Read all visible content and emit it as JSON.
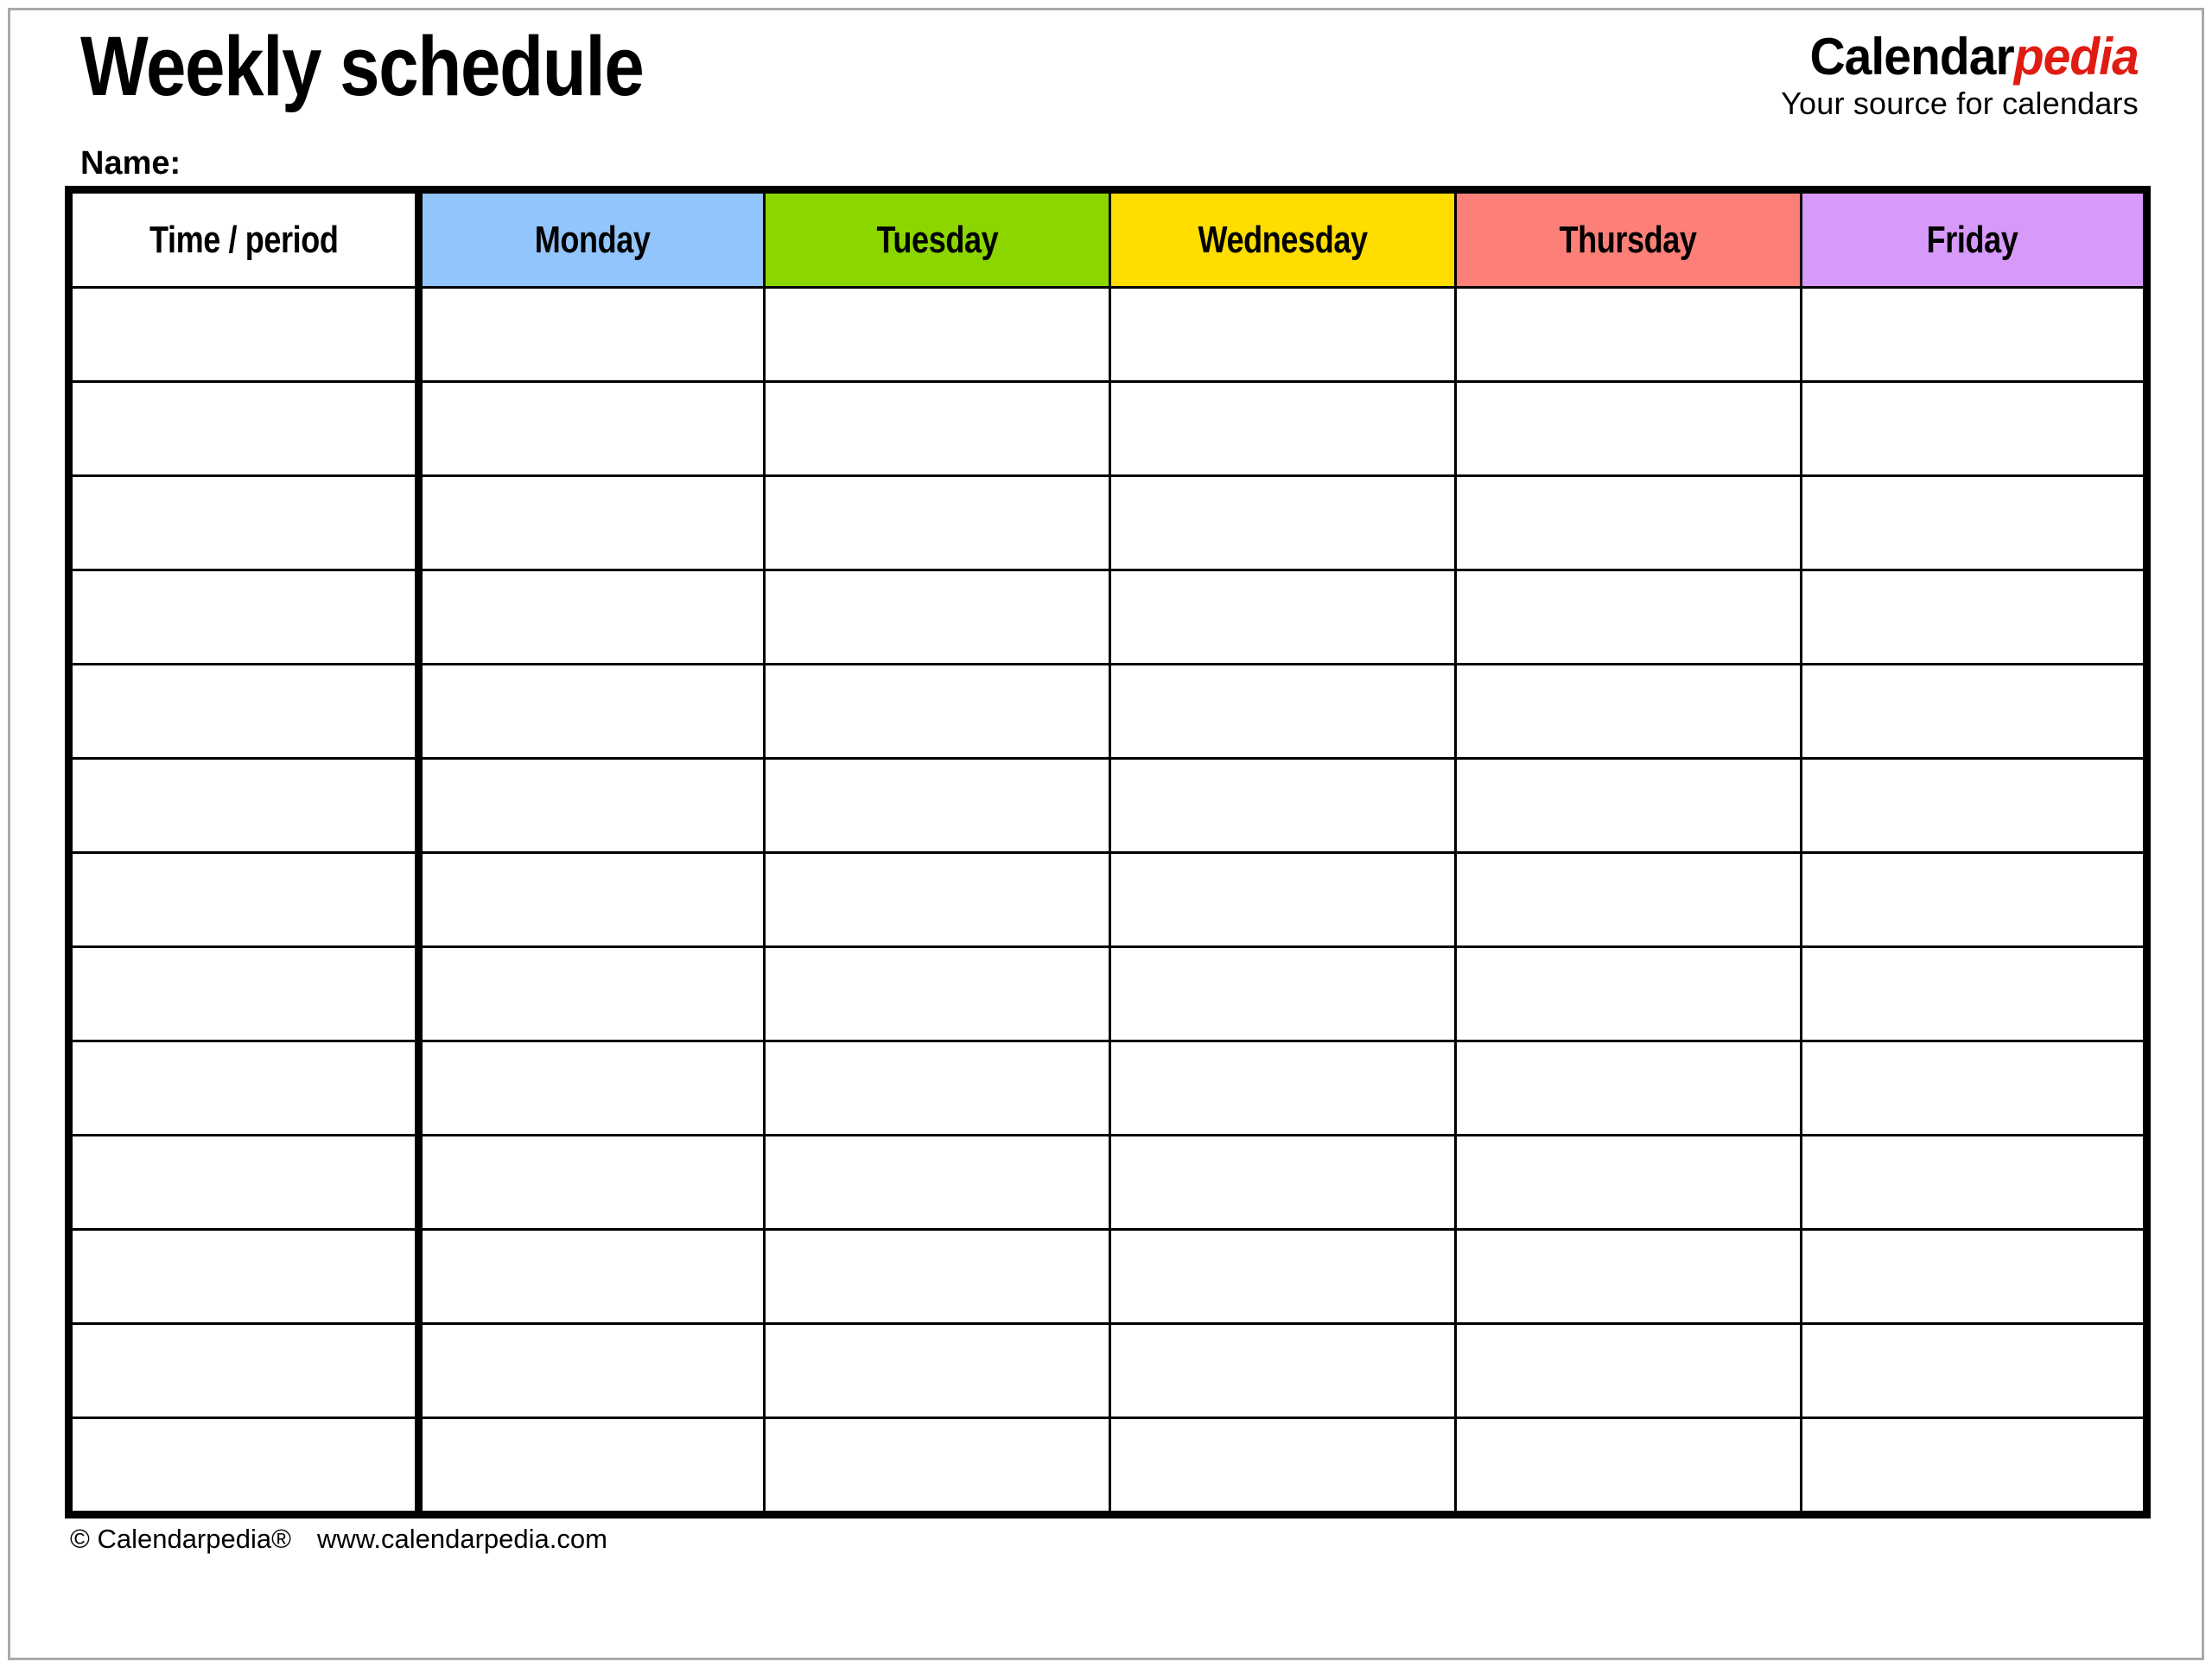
{
  "document": {
    "title": "Weekly schedule",
    "name_label": "Name:"
  },
  "brand": {
    "name_part1": "Calendar",
    "name_part2": "pedia",
    "tagline": "Your source for calendars",
    "accent_color": "#e01b12"
  },
  "table": {
    "columns": [
      {
        "key": "time",
        "label": "Time / period",
        "background": "#ffffff"
      },
      {
        "key": "monday",
        "label": "Monday",
        "background": "#92c5fb"
      },
      {
        "key": "tuesday",
        "label": "Tuesday",
        "background": "#8cd600"
      },
      {
        "key": "wednesday",
        "label": "Wednesday",
        "background": "#ffdd00"
      },
      {
        "key": "thursday",
        "label": "Thursday",
        "background": "#fc8077"
      },
      {
        "key": "friday",
        "label": "Friday",
        "background": "#d89afa"
      }
    ],
    "row_count": 13,
    "rows": [
      {
        "time": "",
        "monday": "",
        "tuesday": "",
        "wednesday": "",
        "thursday": "",
        "friday": ""
      },
      {
        "time": "",
        "monday": "",
        "tuesday": "",
        "wednesday": "",
        "thursday": "",
        "friday": ""
      },
      {
        "time": "",
        "monday": "",
        "tuesday": "",
        "wednesday": "",
        "thursday": "",
        "friday": ""
      },
      {
        "time": "",
        "monday": "",
        "tuesday": "",
        "wednesday": "",
        "thursday": "",
        "friday": ""
      },
      {
        "time": "",
        "monday": "",
        "tuesday": "",
        "wednesday": "",
        "thursday": "",
        "friday": ""
      },
      {
        "time": "",
        "monday": "",
        "tuesday": "",
        "wednesday": "",
        "thursday": "",
        "friday": ""
      },
      {
        "time": "",
        "monday": "",
        "tuesday": "",
        "wednesday": "",
        "thursday": "",
        "friday": ""
      },
      {
        "time": "",
        "monday": "",
        "tuesday": "",
        "wednesday": "",
        "thursday": "",
        "friday": ""
      },
      {
        "time": "",
        "monday": "",
        "tuesday": "",
        "wednesday": "",
        "thursday": "",
        "friday": ""
      },
      {
        "time": "",
        "monday": "",
        "tuesday": "",
        "wednesday": "",
        "thursday": "",
        "friday": ""
      },
      {
        "time": "",
        "monday": "",
        "tuesday": "",
        "wednesday": "",
        "thursday": "",
        "friday": ""
      },
      {
        "time": "",
        "monday": "",
        "tuesday": "",
        "wednesday": "",
        "thursday": "",
        "friday": ""
      },
      {
        "time": "",
        "monday": "",
        "tuesday": "",
        "wednesday": "",
        "thursday": "",
        "friday": ""
      }
    ]
  },
  "footer": {
    "copyright": "© Calendarpedia®",
    "website": "www.calendarpedia.com"
  }
}
